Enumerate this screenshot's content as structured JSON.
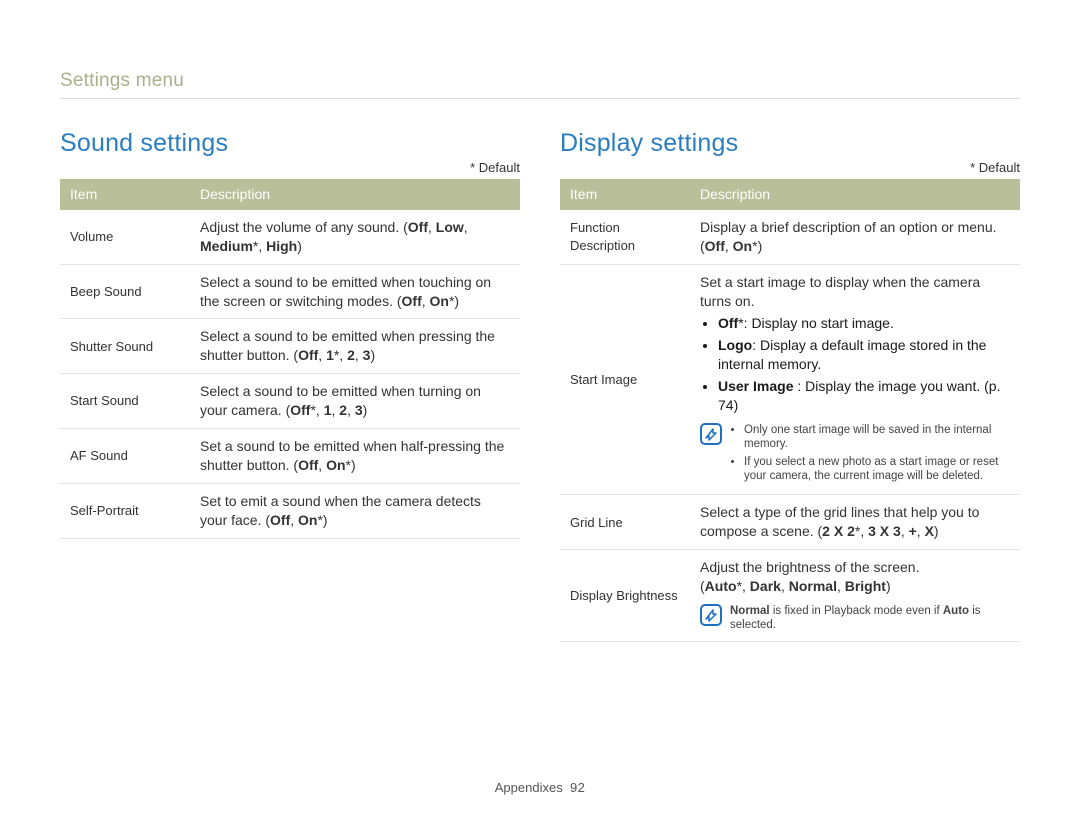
{
  "breadcrumb": "Settings menu",
  "default_note": "* Default",
  "table_headers": {
    "item": "Item",
    "description": "Description"
  },
  "left": {
    "title": "Sound settings",
    "rows": [
      {
        "item": "Volume",
        "desc_html": "Adjust the volume of any sound. (<b>Off</b>, <b>Low</b>, <b>Medium</b>*, <b>High</b>)"
      },
      {
        "item": "Beep Sound",
        "desc_html": "Select a sound to be emitted when touching on the screen or switching modes. (<b>Off</b>, <b>On</b>*)"
      },
      {
        "item": "Shutter Sound",
        "desc_html": "Select a sound to be emitted when pressing the shutter button. (<b>Off</b>, <b>1</b>*, <b>2</b>, <b>3</b>)"
      },
      {
        "item": "Start Sound",
        "desc_html": "Select a sound to be emitted when turning on your camera. (<b>Off</b>*, <b>1</b>, <b>2</b>, <b>3</b>)"
      },
      {
        "item": "AF Sound",
        "desc_html": "Set a sound to be emitted when half-pressing the shutter button. (<b>Off</b>, <b>On</b>*)"
      },
      {
        "item": "Self-Portrait",
        "desc_html": "Set to emit a sound when the camera detects your face. (<b>Off</b>, <b>On</b>*)"
      }
    ]
  },
  "right": {
    "title": "Display settings",
    "rows": [
      {
        "item": "Function Description",
        "desc_html": "Display a brief description of an option or menu. (<b>Off</b>, <b>On</b>*)"
      },
      {
        "item": "Start Image",
        "desc_main": "Set a start image to display when the camera turns on.",
        "options": [
          "<b>Off</b>*: Display no start image.",
          "<b>Logo</b>: Display a default image stored in the internal memory.",
          "<b>User Image</b>&nbsp;: Display the image you want. (p. 74)"
        ],
        "notes": [
          "Only one start image will be saved in the internal memory.",
          "If you select a new photo as a start image or reset your camera, the current image will be deleted."
        ]
      },
      {
        "item": "Grid Line",
        "desc_html": "Select a type of the grid lines that help you to compose a scene. (<b>2 X 2</b>*, <b>3 X 3</b>, <b>+</b>, <b>X</b>)"
      },
      {
        "item": "Display Brightness",
        "desc_main": "Adjust the brightness of the screen.",
        "options_inline": "(<b>Auto</b>*, <b>Dark</b>, <b>Normal</b>, <b>Bright</b>)",
        "notes_single": "<b>Normal</b> is fixed in Playback mode even if <b>Auto</b> is selected."
      }
    ]
  },
  "footer": {
    "section": "Appendixes",
    "page": "92"
  }
}
